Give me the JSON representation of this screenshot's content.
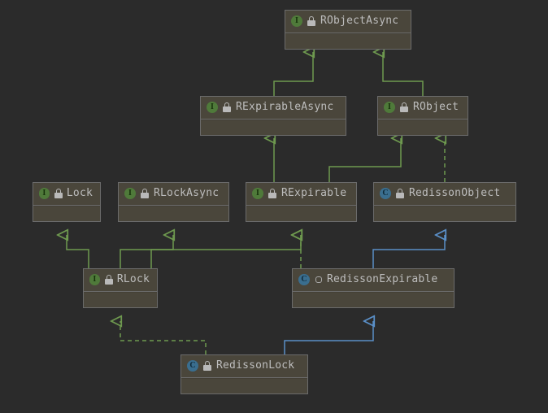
{
  "colors": {
    "background": "#2b2b2b",
    "node_fill": "#4a463b",
    "node_border": "#6b6b6b",
    "text": "#bdbdbd",
    "interface_badge": "#4f7a3a",
    "class_badge": "#3a6e8f",
    "extends_interface_arrow": "#6e994f",
    "extends_class_arrow": "#5a8fc8"
  },
  "nodes": {
    "RObjectAsync": {
      "name": "RObjectAsync",
      "kind": "interface"
    },
    "RExpirableAsync": {
      "name": "RExpirableAsync",
      "kind": "interface"
    },
    "RObject": {
      "name": "RObject",
      "kind": "interface"
    },
    "Lock": {
      "name": "Lock",
      "kind": "interface"
    },
    "RLockAsync": {
      "name": "RLockAsync",
      "kind": "interface"
    },
    "RExpirable": {
      "name": "RExpirable",
      "kind": "interface"
    },
    "RedissonObject": {
      "name": "RedissonObject",
      "kind": "class"
    },
    "RLock": {
      "name": "RLock",
      "kind": "interface"
    },
    "RedissonExpirable": {
      "name": "RedissonExpirable",
      "kind": "class",
      "abstract": true
    },
    "RedissonLock": {
      "name": "RedissonLock",
      "kind": "class"
    }
  },
  "edges": [
    {
      "from": "RExpirableAsync",
      "to": "RObjectAsync",
      "relation": "extends",
      "style": "solid-green"
    },
    {
      "from": "RObject",
      "to": "RObjectAsync",
      "relation": "extends",
      "style": "solid-green"
    },
    {
      "from": "RExpirable",
      "to": "RExpirableAsync",
      "relation": "extends",
      "style": "solid-green"
    },
    {
      "from": "RExpirable",
      "to": "RObject",
      "relation": "extends",
      "style": "solid-green"
    },
    {
      "from": "RedissonObject",
      "to": "RObject",
      "relation": "implements",
      "style": "dashed-green"
    },
    {
      "from": "RLock",
      "to": "Lock",
      "relation": "extends",
      "style": "solid-green"
    },
    {
      "from": "RLock",
      "to": "RLockAsync",
      "relation": "extends",
      "style": "solid-green"
    },
    {
      "from": "RLock",
      "to": "RExpirable",
      "relation": "extends",
      "style": "solid-green"
    },
    {
      "from": "RedissonExpirable",
      "to": "RExpirable",
      "relation": "implements",
      "style": "dashed-green"
    },
    {
      "from": "RedissonExpirable",
      "to": "RedissonObject",
      "relation": "extends",
      "style": "solid-blue"
    },
    {
      "from": "RedissonLock",
      "to": "RLock",
      "relation": "implements",
      "style": "dashed-green"
    },
    {
      "from": "RedissonLock",
      "to": "RedissonExpirable",
      "relation": "extends",
      "style": "solid-blue"
    }
  ]
}
